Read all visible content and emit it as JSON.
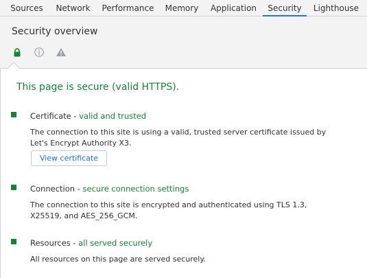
{
  "tabs": [
    {
      "label": "Sources",
      "active": false
    },
    {
      "label": "Network",
      "active": false
    },
    {
      "label": "Performance",
      "active": false
    },
    {
      "label": "Memory",
      "active": false
    },
    {
      "label": "Application",
      "active": false
    },
    {
      "label": "Security",
      "active": true
    },
    {
      "label": "Lighthouse",
      "active": false
    }
  ],
  "overview": {
    "title": "Security overview",
    "icons": [
      "lock-icon",
      "info-icon",
      "warning-icon"
    ]
  },
  "summary": "This page is secure (valid HTTPS).",
  "sections": [
    {
      "label": "Certificate",
      "separator": " - ",
      "status": "valid and trusted",
      "description": "The connection to this site is using a valid, trusted server certificate issued by Let's Encrypt Authority X3.",
      "button": "View certificate"
    },
    {
      "label": "Connection",
      "separator": " - ",
      "status": "secure connection settings",
      "description": "The connection to this site is encrypted and authenticated using TLS 1.3, X25519, and AES_256_GCM."
    },
    {
      "label": "Resources",
      "separator": " - ",
      "status": "all served securely",
      "description": "All resources on this page are served securely."
    }
  ],
  "colors": {
    "secure": "#188038",
    "accent": "#1a73e8",
    "icon_inactive": "#9aa0a6"
  }
}
